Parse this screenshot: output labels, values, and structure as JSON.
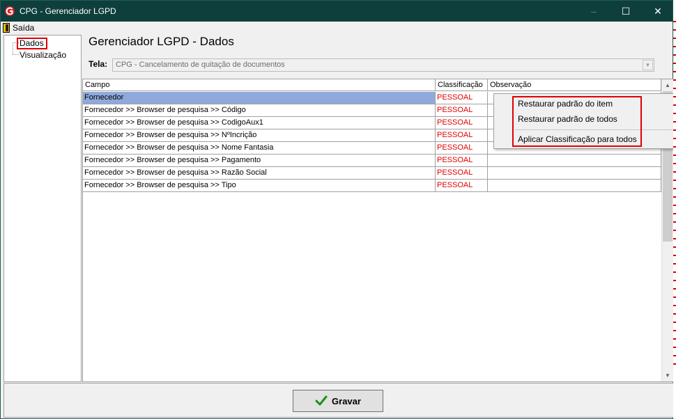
{
  "window": {
    "title": "CPG - Gerenciador LGPD",
    "controls": {
      "minimize": "–",
      "maximize": "☐",
      "close": "✕"
    }
  },
  "menu": {
    "saida": "Saída"
  },
  "tree": {
    "items": [
      {
        "label": "Dados"
      },
      {
        "label": "Visualização"
      }
    ]
  },
  "main": {
    "heading": "Gerenciador LGPD - Dados",
    "tela_label": "Tela:",
    "tela_value": "CPG - Cancelamento de quitação de documentos"
  },
  "grid": {
    "columns": [
      "Campo",
      "Classificação",
      "Observação"
    ],
    "rows": [
      {
        "campo": "Fornecedor",
        "classificacao": "PESSOAL",
        "observacao": ""
      },
      {
        "campo": "Fornecedor >> Browser de pesquisa >> Código",
        "classificacao": "PESSOAL",
        "observacao": ""
      },
      {
        "campo": "Fornecedor >> Browser de pesquisa >> CodigoAux1",
        "classificacao": "PESSOAL",
        "observacao": ""
      },
      {
        "campo": "Fornecedor >> Browser de pesquisa >> NºIncrição",
        "classificacao": "PESSOAL",
        "observacao": ""
      },
      {
        "campo": "Fornecedor >> Browser de pesquisa >> Nome Fantasia",
        "classificacao": "PESSOAL",
        "observacao": ""
      },
      {
        "campo": "Fornecedor >> Browser de pesquisa >> Pagamento",
        "classificacao": "PESSOAL",
        "observacao": ""
      },
      {
        "campo": "Fornecedor >> Browser de pesquisa >> Razão Social",
        "classificacao": "PESSOAL",
        "observacao": ""
      },
      {
        "campo": "Fornecedor >> Browser de pesquisa >> Tipo",
        "classificacao": "PESSOAL",
        "observacao": ""
      }
    ]
  },
  "context_menu": {
    "items": [
      {
        "label": "Restaurar padrão do item"
      },
      {
        "label": "Restaurar padrão de todos"
      },
      {
        "label": "Aplicar Classificação para todos"
      }
    ]
  },
  "buttons": {
    "gravar": "Gravar"
  },
  "colors": {
    "titlebar": "#0e3f3c",
    "classification_text": "#e00000",
    "selected_row": "#8fa9dc",
    "annotation_highlight": "#e00000"
  },
  "icons": {
    "app": "cpg-logo-icon",
    "saida": "door-exit-icon",
    "gravar": "checkmark-icon"
  }
}
